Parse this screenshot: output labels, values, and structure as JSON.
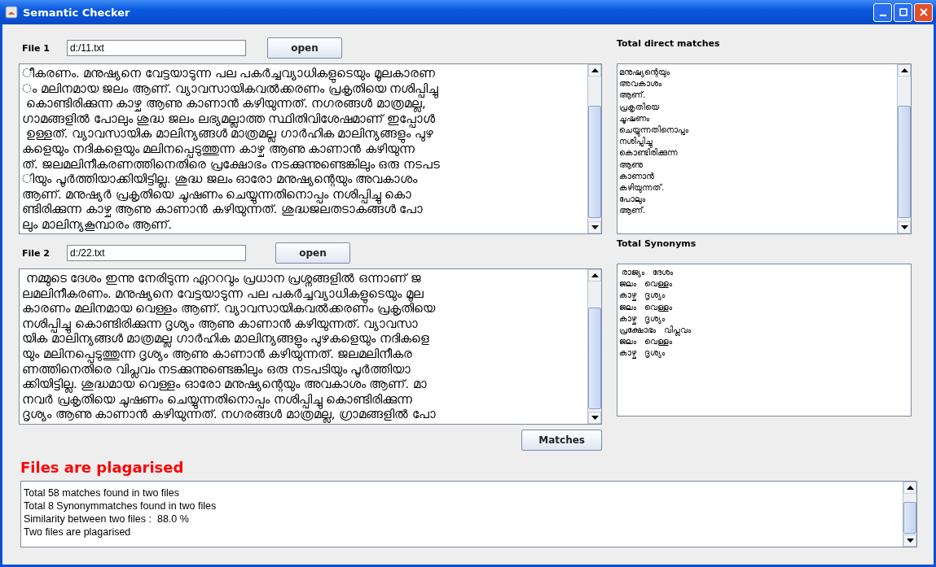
{
  "window": {
    "title": "Semantic Checker"
  },
  "file1": {
    "label": "File 1",
    "path": "d:/11.txt",
    "button": "open",
    "lines": [
      "ീകരണം. മനുഷ്യനെ വേട്ടയാടുന്ന പല പകർച്ചവ്യാധികളുടെയും മൂലകാരണ",
      "ം മലിനമായ ജലം ആണ്. വ്യാവസായികവൽക്കരണം പ്രകൃതിയെ നശിപ്പിച്ചു",
      " കൊണ്ടിരിക്കുന്ന കാഴ്ച ആണു കാണാൻ കഴിയുന്നത്. നഗരങ്ങൾ മാത്രമല്ല,",
      "ഗാമങ്ങളിൽ പോലും ശുദ്ധ ജലം ലഭ്യമല്ലാത്ത സ്ഥിതിവിശേഷമാണ് ഇപ്പോൾ",
      " ഉള്ളത്. വ്യാവസായിക മാലിന്യങ്ങൾ മാത്രമല്ല ഗാർഹിക മാലിന്യങ്ങളും പുഴ",
      "കളെയും നദികളെയും മലിനപ്പെടുത്തുന്ന കാഴ്ച ആണു കാണാൻ കഴിയുന്ന",
      "ത്. ജലമലിനീകരണത്തിനെതിരെ പ്രക്ഷോഭം നടക്കുന്നുണ്ടെങ്കിലും ഒരു നടപട",
      "ിയും പൂർത്തിയാക്കിയിട്ടില്ല. ശുദ്ധ ജലം ഓരോ മനുഷ്യന്റെയും അവകാശം",
      "ആണ്. മനുഷ്യർ പ്രകൃതിയെ ചൂഷണം ചെയ്യുന്നതിനൊപ്പം നശിപ്പിച്ചു കൊ",
      "ണ്ടിരിക്കുന്ന കാഴ്ച ആണു കാണാൻ കഴിയുന്നത്. ശുദ്ധജലതടാകങ്ങൾ പോ",
      "ലും മാലിന്യകൂമ്പാരം ആണ്."
    ]
  },
  "file2": {
    "label": "File 2",
    "path": "d:/22.txt",
    "button": "open",
    "lines": [
      " നമ്മുടെ ദേശം ഇന്നു നേരിടുന്ന ഏററവും പ്രധാന പ്രശ്നങ്ങളിൽ ഒന്നാണ് ജ",
      "ലമലിനീകരണം. മനുഷ്യനെ വേട്ടയാടുന്ന പല പകർച്ചവ്യാധികളുടെയും മൂല",
      "കാരണം മലിനമായ വെള്ളം ആണ്. വ്യാവസായികവൽക്കരണം പ്രകൃതിയെ",
      "നശിപ്പിച്ചു കൊണ്ടിരിക്കുന്ന ദൃശ്യം ആണു കാണാൻ കഴിയുന്നത്. വ്യാവസാ",
      "യിക മാലിന്യങ്ങൾ മാത്രമല്ല ഗാർഹിക മാലിന്യങ്ങളും പുഴകളെയും നദികളെ",
      "യും മലിനപ്പെടുത്തുന്ന ദൃശ്യം ആണു കാണാൻ കഴിയുന്നത്. ജലമലിനീകര",
      "ണത്തിനെതിരെ വിപ്ലവം നടക്കുന്നുണ്ടെങ്കിലും ഒരു നടപടിയും പൂർത്തിയാ",
      "ക്കിയിട്ടില്ല. ശുദ്ധമായ വെള്ളം ഓരോ മനുഷ്യന്റെയും അവകാശം ആണ്. മാ",
      "നവർ പ്രകൃതിയെ ചൂഷണം ചെയ്യുന്നതിനൊപ്പം നശിപ്പിച്ചു കൊണ്ടിരിക്കുന്ന",
      "ദൃശ്യം ആണു കാണാൻ കഴിയുന്നത്. നഗരങ്ങൾ മാത്രമല്ല, ഗ്രാമങ്ങളിൽ പോ"
    ]
  },
  "direct_matches": {
    "title": "Total direct matches",
    "items": [
      "മനുഷ്യന്റെയും",
      "അവകാശം",
      "ആണ്.",
      "പ്രകൃതിയെ",
      "ചൂഷണം",
      "ചെയ്യുന്നതിനൊപ്പം",
      "നശിപ്പിച്ചു",
      "കൊണ്ടിരിക്കുന്ന",
      "ആണു",
      "കാണാൻ",
      "കഴിയുന്നത്.",
      "പോലും",
      "ആണ്."
    ]
  },
  "synonyms": {
    "title": "Total Synonyms",
    "items": [
      " രാജ്യം   ദേശം",
      "ജലം   വെള്ളം",
      "കാഴ്ച   ദൃശ്യം",
      "ജലം   വെള്ളം",
      "കാഴ്ച   ദൃശ്യം",
      "പ്രക്ഷോഭം   വിപ്ലവം",
      "ജലം   വെള്ളം",
      "കാഴ്ച   ദൃശ്യം"
    ]
  },
  "matches_button": "Matches",
  "verdict": "Files are plagarised",
  "output": [
    "Total 58 matches found in two files",
    "Total 8 Synonymmatches found in two files",
    "Similarity between two files :  88.0 %",
    "Two files are plagarised"
  ]
}
